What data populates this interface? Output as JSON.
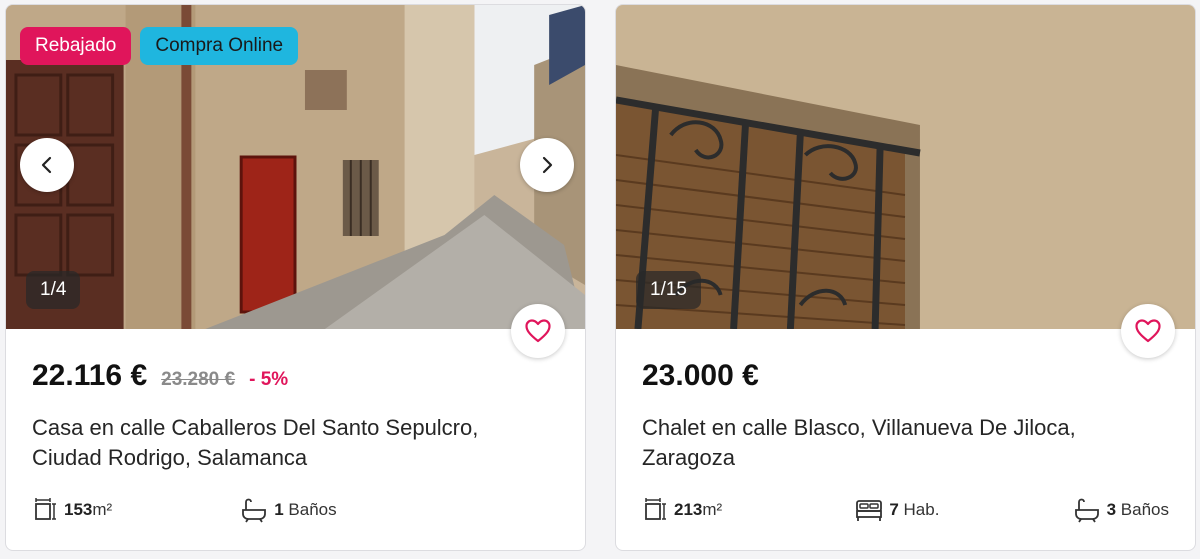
{
  "listings": [
    {
      "badges": {
        "discount": "Rebajado",
        "online": "Compra Online"
      },
      "counter": "1/4",
      "price": "22.116 €",
      "old_price": "23.280 €",
      "discount_pct": "- 5%",
      "title": "Casa en calle Caballeros Del Santo Sepulcro, Ciudad Rodrigo, Salamanca",
      "features": {
        "area": "153",
        "area_unit": "m²",
        "baths": "1",
        "baths_label": "Baños"
      }
    },
    {
      "counter": "1/15",
      "price": "23.000 €",
      "title": "Chalet en calle Blasco, Villanueva De Jiloca, Zaragoza",
      "features": {
        "area": "213",
        "area_unit": "m²",
        "rooms": "7",
        "rooms_label": "Hab.",
        "baths": "3",
        "baths_label": "Baños"
      }
    }
  ],
  "colors": {
    "accent": "#e0155b",
    "online_badge": "#1fb6df"
  },
  "icons": [
    "chevron-left-icon",
    "chevron-right-icon",
    "heart-icon",
    "area-icon",
    "bed-icon",
    "bathtub-icon"
  ]
}
